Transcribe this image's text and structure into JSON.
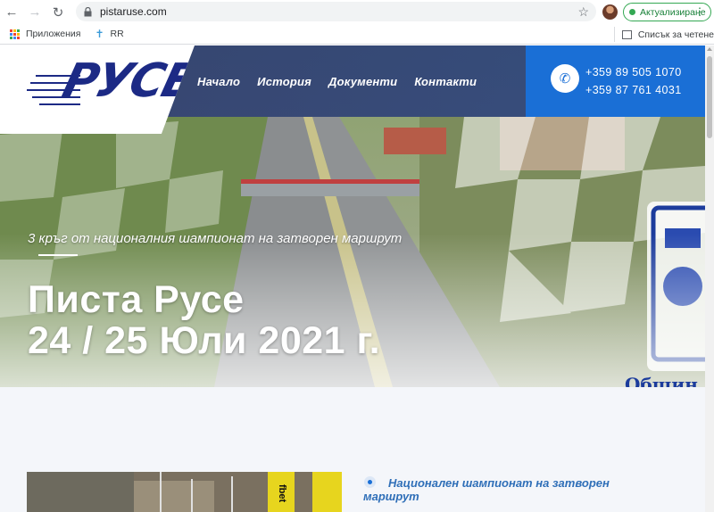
{
  "browser": {
    "url": "pistaruse.com",
    "update_label": "Актуализиране",
    "icons": {
      "back": "back-arrow-icon",
      "forward": "forward-arrow-icon",
      "reload": "reload-icon",
      "lock": "lock-icon",
      "star": "star-icon",
      "menu": "kebab-menu-icon"
    }
  },
  "bookmarks": {
    "apps_label": "Приложения",
    "rr_label": "RR",
    "reading_list_label": "Списък за четене"
  },
  "site": {
    "logo_text": "РУСЕ",
    "nav": [
      {
        "label": "Начало"
      },
      {
        "label": "История"
      },
      {
        "label": "Документи"
      },
      {
        "label": "Контакти"
      }
    ],
    "phones": [
      "+359 89 505 1070",
      "+359 87 761 4031"
    ],
    "hero": {
      "subtitle": "3 кръг от националния шампионат на затворен маршрут",
      "title_line1": "Писта Русе",
      "title_line2": "24 / 25 Юли 2021 г.",
      "emblem_caption": "Общин"
    },
    "news": {
      "title": "Национален шампионат на затворен маршрут",
      "banner_text": "fbet"
    }
  },
  "colors": {
    "accent_blue": "#1a6fd6",
    "header_navy": "#28346e",
    "logo_navy": "#1c2a85",
    "update_green": "#188038"
  }
}
